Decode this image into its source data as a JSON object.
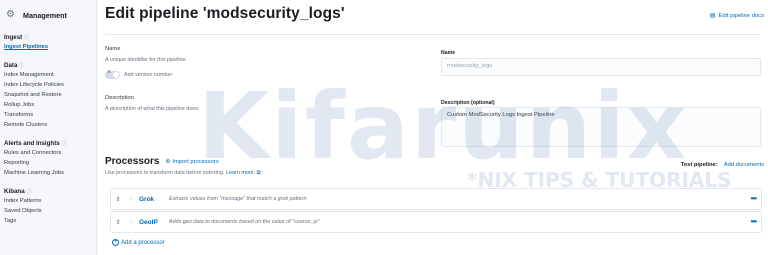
{
  "sidebar": {
    "title": "Management",
    "sections": [
      {
        "title": "Ingest",
        "items": [
          "Ingest Pipelines"
        ],
        "active": 0
      },
      {
        "title": "Data",
        "items": [
          "Index Management",
          "Index Lifecycle Policies",
          "Snapshot and Restore",
          "Rollup Jobs",
          "Transforms",
          "Remote Clusters"
        ]
      },
      {
        "title": "Alerts and Insights",
        "items": [
          "Rules and Connectors",
          "Reporting",
          "Machine Learning Jobs"
        ]
      },
      {
        "title": "Kibana",
        "items": [
          "Index Patterns",
          "Saved Objects",
          "Tags"
        ]
      }
    ]
  },
  "page": {
    "title": "Edit pipeline 'modsecurity_logs'",
    "edit_docs": "Edit pipeline docs"
  },
  "form": {
    "name_label": "Name",
    "name_sub": "A unique identifier for this pipeline.",
    "version_toggle": "Add version number",
    "desc_label": "Description",
    "desc_sub": "A description of what this pipeline does.",
    "name_field_label": "Name",
    "name_value": "modsecurity_logs",
    "desc_field_label": "Description (optional)",
    "desc_value": "Custom ModSecurity Logs Ingest Pipeline"
  },
  "processors": {
    "title": "Processors",
    "import_label": "Import processors",
    "subtitle": "Use processors to transform data before indexing.",
    "learn_more": "Learn more.",
    "test_label": "Test pipeline:",
    "add_documents": "Add documents",
    "items": [
      {
        "name": "Grok",
        "desc": "Extracts values from \"message\" that match a grok pattern"
      },
      {
        "name": "GeoIP",
        "desc": "Adds geo data to documents based on the value of \"source_ip\""
      }
    ],
    "add_processor": "Add a processor"
  },
  "watermark": {
    "main": "Kifarunix",
    "sub": "*NIX TIPS & TUTORIALS"
  },
  "colors": {
    "accent": "#006bb8",
    "sidebar_bg": "#f5f7fa"
  }
}
